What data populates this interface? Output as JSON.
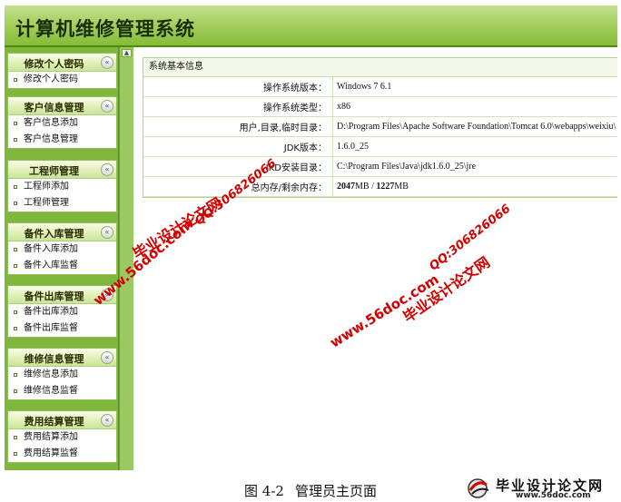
{
  "app": {
    "title": "计算机维修管理系统"
  },
  "sidebar": {
    "groups": [
      {
        "title": "修改个人密码",
        "items": [
          "修改个人密码"
        ]
      },
      {
        "title": "客户信息管理",
        "items": [
          "客户信息添加",
          "客户信息管理"
        ]
      },
      {
        "title": "工程师管理",
        "items": [
          "工程师添加",
          "工程师管理"
        ]
      },
      {
        "title": "备件入库管理",
        "items": [
          "备件入库添加",
          "备件入库监督"
        ]
      },
      {
        "title": "备件出库管理",
        "items": [
          "备件出库添加",
          "备件出库监督"
        ]
      },
      {
        "title": "维修信息管理",
        "items": [
          "维修信息添加",
          "维修信息监督"
        ]
      },
      {
        "title": "费用结算管理",
        "items": [
          "费用结算添加",
          "费用结算监督"
        ]
      }
    ],
    "toggle_glyph": "«",
    "splitter_glyph": "▲"
  },
  "panel": {
    "title": "系统基本信息",
    "rows": [
      {
        "key": "操作系统版本：",
        "value": "Windows 7  6.1"
      },
      {
        "key": "操作系统类型：",
        "value": "x86"
      },
      {
        "key": "用户,目录,临时目录：",
        "value": "D:\\Program Files\\Apache Software Foundation\\Tomcat 6.0\\webapps\\weixiu\\"
      },
      {
        "key": "JDK版本：",
        "value": "1.6.0_25"
      },
      {
        "key": "JKD安装目录：",
        "value": "C:\\Program Files\\Java\\jdk1.6.0_25\\jre"
      }
    ],
    "memory": {
      "key": "总内存/剩余内存：",
      "total": "2047",
      "unit_total": "MB",
      "sep": " / ",
      "free": "1227",
      "unit_free": "MB"
    }
  },
  "watermarks": {
    "cn": "毕业设计论文网",
    "qq": "QQ:306826066",
    "site": "www.56doc.com"
  },
  "caption": {
    "figure": "图 4-2",
    "text": "管理员主页面"
  },
  "logo": {
    "text": "毕业设计论文网",
    "url": "www.56doc.com"
  },
  "colors": {
    "header": "#a6d061",
    "sidebar": "#7fb73c",
    "watermark": "#d40000"
  }
}
